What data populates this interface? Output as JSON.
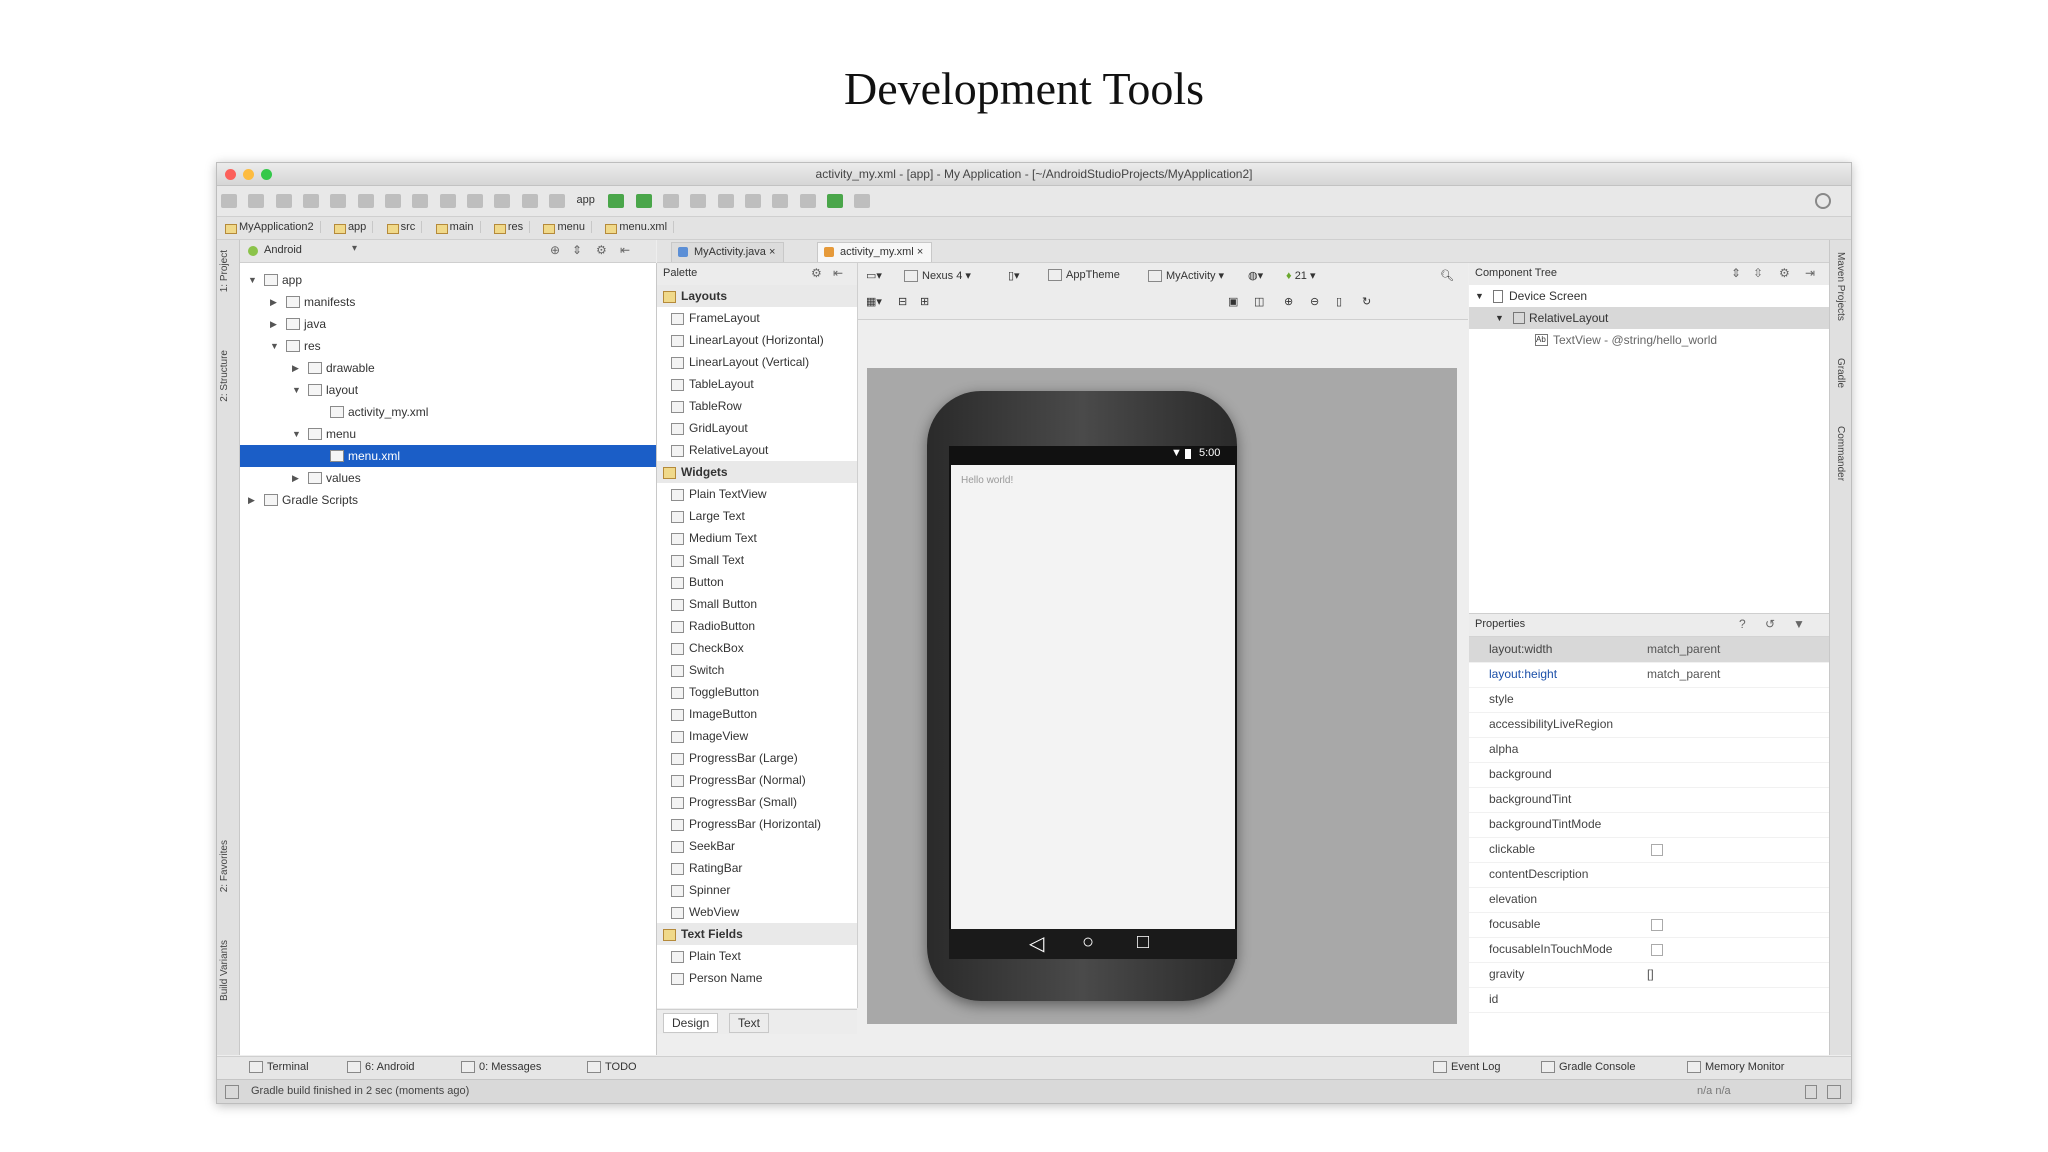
{
  "slide": {
    "title": "Development Tools"
  },
  "window": {
    "title": "activity_my.xml - [app] - My Application - [~/AndroidStudioProjects/MyApplication2]",
    "traffic_colors": [
      "#fc605b",
      "#fdbc40",
      "#34c84a"
    ]
  },
  "toolbar": {
    "run_config": "app"
  },
  "breadcrumbs": [
    "MyApplication2",
    "app",
    "src",
    "main",
    "res",
    "menu",
    "menu.xml"
  ],
  "left_strip": {
    "tabs": [
      "1: Project",
      "2: Structure",
      "2: Favorites",
      "Build Variants"
    ]
  },
  "right_strip": {
    "tabs": [
      "Maven Projects",
      "Gradle",
      "Commander"
    ]
  },
  "project": {
    "view": "Android",
    "tree": [
      {
        "label": "app",
        "depth": 0,
        "expanded": true,
        "selected": false
      },
      {
        "label": "manifests",
        "depth": 1,
        "expanded": false,
        "selected": false
      },
      {
        "label": "java",
        "depth": 1,
        "expanded": false,
        "selected": false
      },
      {
        "label": "res",
        "depth": 1,
        "expanded": true,
        "selected": false
      },
      {
        "label": "drawable",
        "depth": 2,
        "expanded": false,
        "selected": false
      },
      {
        "label": "layout",
        "depth": 2,
        "expanded": true,
        "selected": false
      },
      {
        "label": "activity_my.xml",
        "depth": 3,
        "expanded": null,
        "selected": false
      },
      {
        "label": "menu",
        "depth": 2,
        "expanded": true,
        "selected": false
      },
      {
        "label": "menu.xml",
        "depth": 3,
        "expanded": null,
        "selected": true
      },
      {
        "label": "values",
        "depth": 2,
        "expanded": false,
        "selected": false
      },
      {
        "label": "Gradle Scripts",
        "depth": 0,
        "expanded": false,
        "selected": false
      }
    ]
  },
  "editor_tabs": [
    {
      "label": "MyActivity.java",
      "active": false
    },
    {
      "label": "activity_my.xml",
      "active": true
    }
  ],
  "palette": {
    "title": "Palette",
    "rows": [
      {
        "label": "Layouts",
        "group": true
      },
      {
        "label": "FrameLayout",
        "group": false
      },
      {
        "label": "LinearLayout (Horizontal)",
        "group": false
      },
      {
        "label": "LinearLayout (Vertical)",
        "group": false
      },
      {
        "label": "TableLayout",
        "group": false
      },
      {
        "label": "TableRow",
        "group": false
      },
      {
        "label": "GridLayout",
        "group": false
      },
      {
        "label": "RelativeLayout",
        "group": false
      },
      {
        "label": "Widgets",
        "group": true
      },
      {
        "label": "Plain TextView",
        "group": false
      },
      {
        "label": "Large Text",
        "group": false
      },
      {
        "label": "Medium Text",
        "group": false
      },
      {
        "label": "Small Text",
        "group": false
      },
      {
        "label": "Button",
        "group": false
      },
      {
        "label": "Small Button",
        "group": false
      },
      {
        "label": "RadioButton",
        "group": false
      },
      {
        "label": "CheckBox",
        "group": false
      },
      {
        "label": "Switch",
        "group": false
      },
      {
        "label": "ToggleButton",
        "group": false
      },
      {
        "label": "ImageButton",
        "group": false
      },
      {
        "label": "ImageView",
        "group": false
      },
      {
        "label": "ProgressBar (Large)",
        "group": false
      },
      {
        "label": "ProgressBar (Normal)",
        "group": false
      },
      {
        "label": "ProgressBar (Small)",
        "group": false
      },
      {
        "label": "ProgressBar (Horizontal)",
        "group": false
      },
      {
        "label": "SeekBar",
        "group": false
      },
      {
        "label": "RatingBar",
        "group": false
      },
      {
        "label": "Spinner",
        "group": false
      },
      {
        "label": "WebView",
        "group": false
      },
      {
        "label": "Text Fields",
        "group": true
      },
      {
        "label": "Plain Text",
        "group": false
      },
      {
        "label": "Person Name",
        "group": false
      }
    ]
  },
  "design_tabs": {
    "design": "Design",
    "text": "Text"
  },
  "canvas_toolbar": {
    "device": "Nexus 4",
    "theme": "AppTheme",
    "activity": "MyActivity",
    "api": "21"
  },
  "device": {
    "status_time": "5:00",
    "content_text": "Hello world!"
  },
  "component_tree": {
    "title": "Component Tree",
    "rows": [
      {
        "label": "Device Screen",
        "selected": false
      },
      {
        "label": "RelativeLayout",
        "selected": true
      },
      {
        "label": "TextView - @string/hello_world",
        "selected": false
      }
    ]
  },
  "properties": {
    "title": "Properties",
    "rows": [
      {
        "name": "layout:width",
        "value": "match_parent",
        "check": false
      },
      {
        "name": "layout:height",
        "value": "match_parent",
        "check": false
      },
      {
        "name": "style",
        "value": "",
        "check": false
      },
      {
        "name": "accessibilityLiveRegion",
        "value": "",
        "check": false
      },
      {
        "name": "alpha",
        "value": "",
        "check": false
      },
      {
        "name": "background",
        "value": "",
        "check": false
      },
      {
        "name": "backgroundTint",
        "value": "",
        "check": false
      },
      {
        "name": "backgroundTintMode",
        "value": "",
        "check": false
      },
      {
        "name": "clickable",
        "value": "",
        "check": true
      },
      {
        "name": "contentDescription",
        "value": "",
        "check": false
      },
      {
        "name": "elevation",
        "value": "",
        "check": false
      },
      {
        "name": "focusable",
        "value": "",
        "check": true
      },
      {
        "name": "focusableInTouchMode",
        "value": "",
        "check": true
      },
      {
        "name": "gravity",
        "value": "[]",
        "check": false
      },
      {
        "name": "id",
        "value": "",
        "check": false
      }
    ]
  },
  "bottom_tools": {
    "left": [
      "Terminal",
      "6: Android",
      "0: Messages",
      "TODO"
    ],
    "right": [
      "Event Log",
      "Gradle Console",
      "Memory Monitor"
    ]
  },
  "status": {
    "message": "Gradle build finished in 2 sec (moments ago)",
    "right": "n/a   n/a"
  }
}
